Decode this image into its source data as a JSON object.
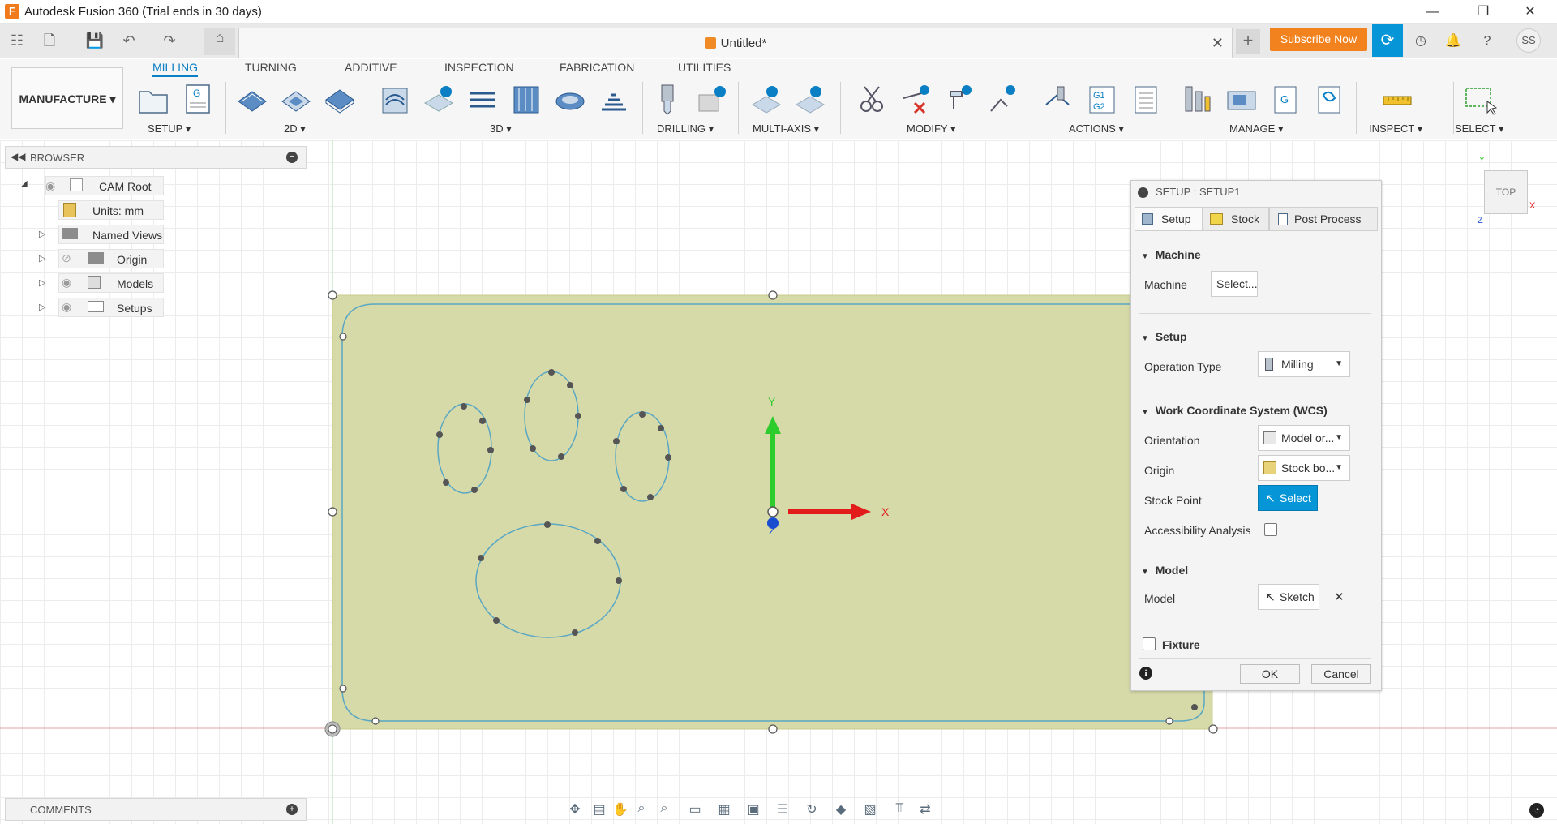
{
  "window": {
    "title": "Autodesk Fusion 360 (Trial ends in 30 days)",
    "app_icon": "F"
  },
  "document": {
    "tab_title": "Untitled*",
    "subscribe_label": "Subscribe Now",
    "user_initials": "SS"
  },
  "toolbar": {
    "workspace": "MANUFACTURE",
    "tabs": [
      "MILLING",
      "TURNING",
      "ADDITIVE",
      "INSPECTION",
      "FABRICATION",
      "UTILITIES"
    ],
    "active_tab": "MILLING",
    "groups": {
      "setup": "SETUP",
      "d2": "2D",
      "d3": "3D",
      "drilling": "DRILLING",
      "multiaxis": "MULTI-AXIS",
      "modify": "MODIFY",
      "actions": "ACTIONS",
      "manage": "MANAGE",
      "inspect": "INSPECT",
      "select": "SELECT"
    },
    "caret": "▾"
  },
  "browser": {
    "title": "BROWSER",
    "items": {
      "root": "CAM Root",
      "units": "Units: mm",
      "named_views": "Named Views",
      "origin": "Origin",
      "models": "Models",
      "setups": "Setups"
    }
  },
  "dialog": {
    "title": "SETUP : SETUP1",
    "tabs": {
      "setup": "Setup",
      "stock": "Stock",
      "post": "Post Process"
    },
    "machine": {
      "heading": "Machine",
      "label": "Machine",
      "button": "Select..."
    },
    "setup": {
      "heading": "Setup",
      "op_label": "Operation Type",
      "op_value": "Milling"
    },
    "wcs": {
      "heading": "Work Coordinate System (WCS)",
      "orientation_label": "Orientation",
      "orientation_value": "Model or...",
      "origin_label": "Origin",
      "origin_value": "Stock bo...",
      "stock_point_label": "Stock Point",
      "stock_point_button": "Select",
      "accessibility_label": "Accessibility Analysis"
    },
    "model": {
      "heading": "Model",
      "label": "Model",
      "value": "Sketch",
      "clear": "✕"
    },
    "fixture": {
      "heading": "Fixture"
    },
    "ok": "OK",
    "cancel": "Cancel",
    "info": "i"
  },
  "viewport": {
    "axis_x": "X",
    "axis_y": "Y",
    "axis_z": "Z",
    "viewcube_face": "TOP",
    "cube_x": "X",
    "cube_y": "Y",
    "cube_z": "Z"
  },
  "comments": {
    "title": "COMMENTS"
  },
  "colors": {
    "accent": "#0696d7",
    "subscribe": "#f2821d",
    "stock_fill": "#d6d9a8",
    "sketch_line": "#5aa7c4"
  }
}
